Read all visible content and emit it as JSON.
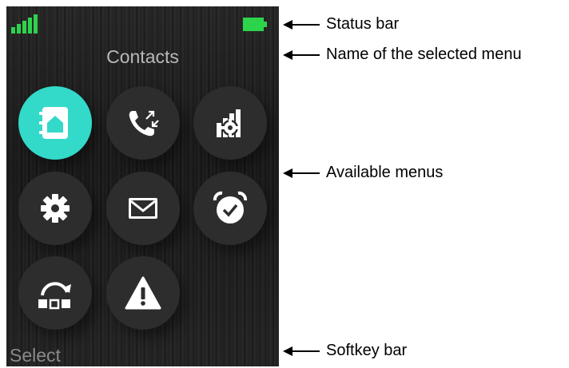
{
  "screen": {
    "title": "Contacts",
    "softkey_left": "Select",
    "accent_color": "#33d9c9",
    "status_color": "#2ed34c",
    "menu_icons": [
      {
        "name": "contacts-icon",
        "selected": true
      },
      {
        "name": "call-list-icon",
        "selected": false
      },
      {
        "name": "connectivity-settings-icon",
        "selected": false
      },
      {
        "name": "settings-gear-icon",
        "selected": false
      },
      {
        "name": "messaging-envelope-icon",
        "selected": false
      },
      {
        "name": "alarm-clock-icon",
        "selected": false
      },
      {
        "name": "connection-switch-icon",
        "selected": false
      },
      {
        "name": "alert-warning-icon",
        "selected": false
      }
    ]
  },
  "annotations": {
    "status_bar": "Status bar",
    "selected_menu_name": "Name of the selected menu",
    "available_menus": "Available menus",
    "softkey_bar": "Softkey bar"
  }
}
